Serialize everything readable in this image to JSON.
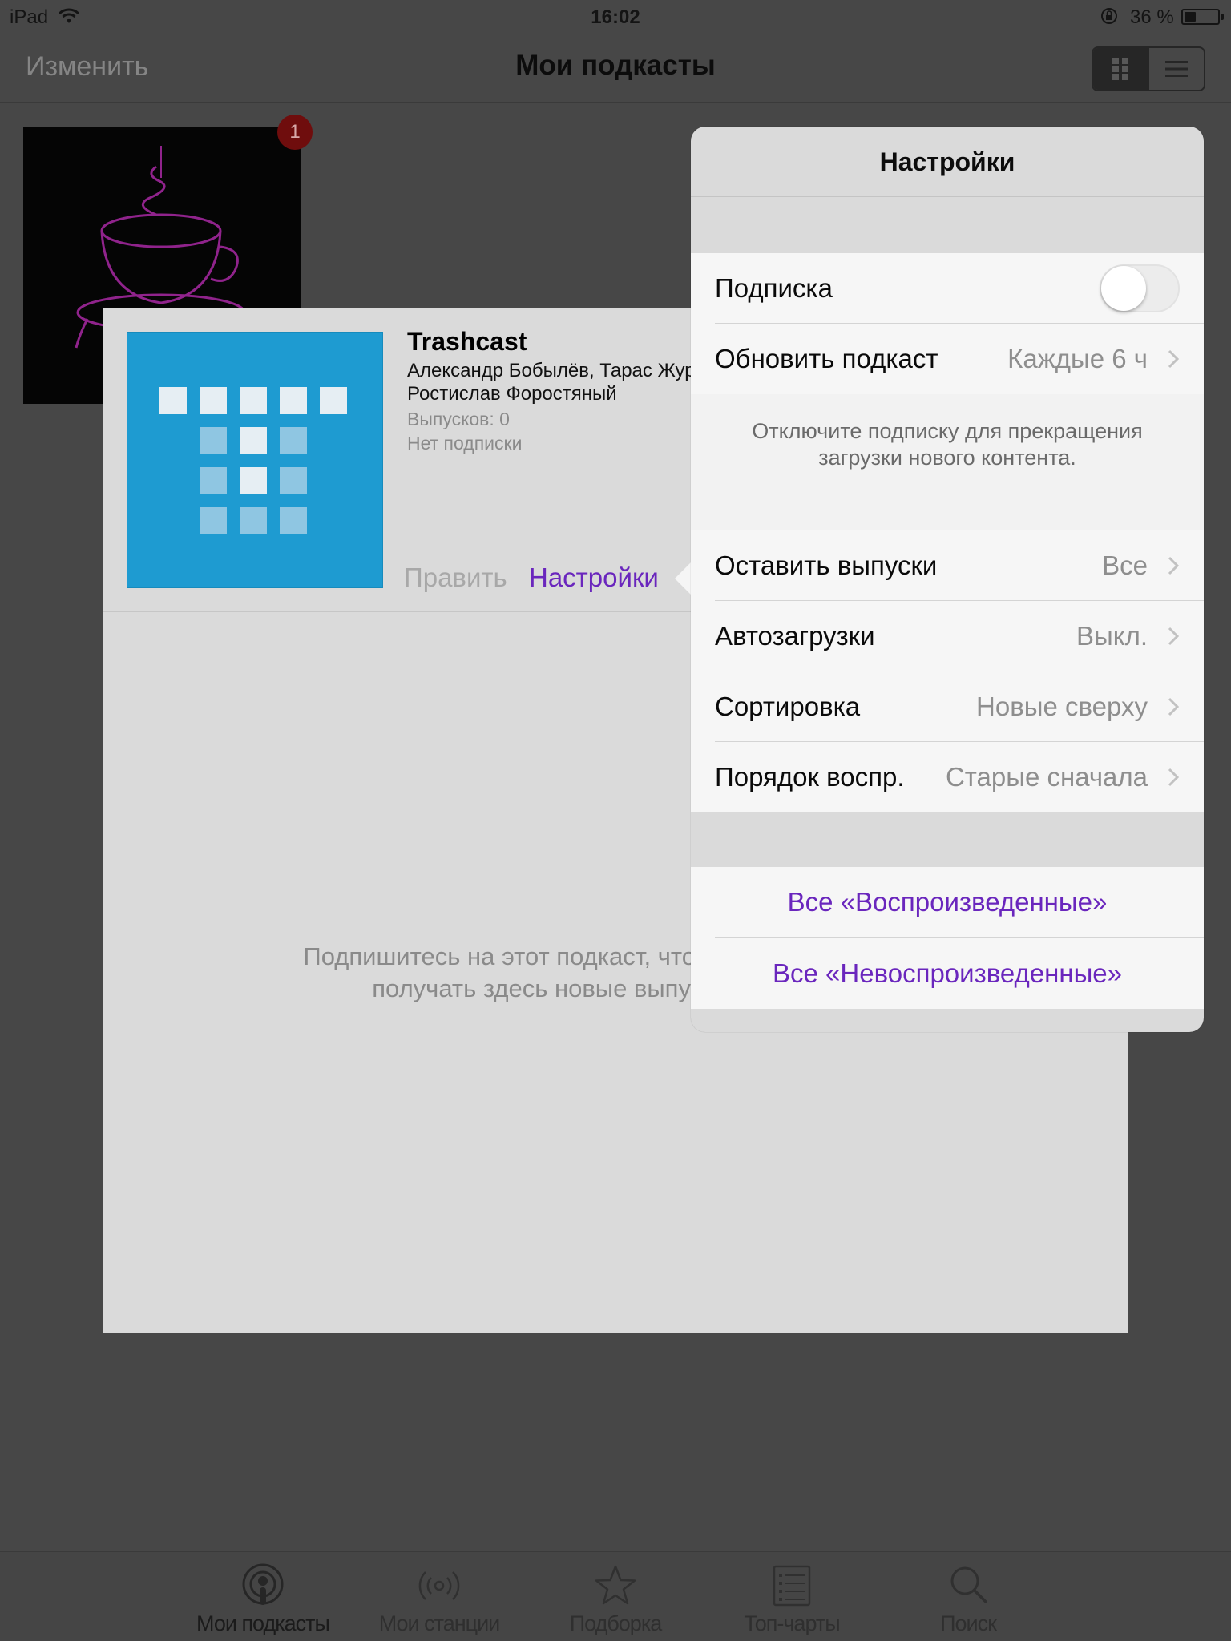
{
  "status_bar": {
    "device": "iPad",
    "time": "16:02",
    "battery_text": "36 %",
    "battery_level": 0.36
  },
  "nav": {
    "edit_label": "Изменить",
    "title": "Мои подкасты"
  },
  "tile": {
    "badge_count": "1"
  },
  "podcast": {
    "title": "Trashcast",
    "authors": "Александр Бобылёв, Тарас Журавлёв, Ростислав Форостяный",
    "episodes": "Выпусков: 0",
    "subscription_status": "Нет подписки",
    "edit_label": "Править",
    "settings_label": "Настройки",
    "empty_message": "Подпишитесь на этот подкаст, чтобы получать здесь новые выпуски"
  },
  "settings": {
    "title": "Настройки",
    "subscription_label": "Подписка",
    "subscription_on": false,
    "refresh_label": "Обновить подкаст",
    "refresh_value": "Каждые 6 ч",
    "note": "Отключите подписку для прекращения загрузки нового контента.",
    "rows": [
      {
        "label": "Оставить выпуски",
        "value": "Все"
      },
      {
        "label": "Автозагрузки",
        "value": "Выкл."
      },
      {
        "label": "Сортировка",
        "value": "Новые сверху"
      },
      {
        "label": "Порядок воспр.",
        "value": "Старые сначала"
      }
    ],
    "mark_played": "Все «Воспроизведенные»",
    "mark_unplayed": "Все «Невоспроизведенные»",
    "accent_color": "#6a26bd"
  },
  "tabs": [
    {
      "label": "Мои подкасты",
      "icon": "podcast-icon"
    },
    {
      "label": "Мои станции",
      "icon": "station-icon"
    },
    {
      "label": "Подборка",
      "icon": "star-icon"
    },
    {
      "label": "Топ-чарты",
      "icon": "list-icon"
    },
    {
      "label": "Поиск",
      "icon": "search-icon"
    }
  ]
}
